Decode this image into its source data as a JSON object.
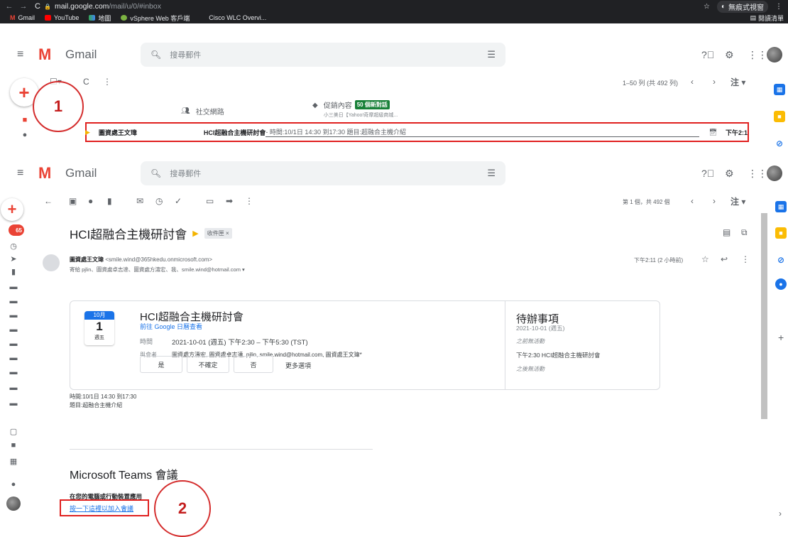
{
  "browser": {
    "url_host": "mail.google.com",
    "url_path": "/mail/u/0/#inbox",
    "incognito_label": "無痕式視窗",
    "bookmarks": [
      "Gmail",
      "YouTube",
      "地圖",
      "vSphere Web 客戶端",
      "Cisco WLC Overvi..."
    ],
    "reading_list": "閱讀清單"
  },
  "gmail": {
    "label": "Gmail",
    "search_placeholder": "搜尋郵件"
  },
  "inbox": {
    "pagination": "1–50 列 (共 492 列)",
    "lang": "注",
    "tabs": {
      "social": "社交網路",
      "promo": "促銷內容",
      "promo_badge": "50 個新對話",
      "promo_sub": "小三美日【Yahoo!奇摩超級商城..."
    },
    "row": {
      "sender": "圖資處王文瑋",
      "subject": "HCI超融合主機研討會",
      "snippet": " - 時間:10/1日 14:30 到17:30 題目:超融合主機介紹",
      "time": "下午2:1"
    },
    "marker": "1"
  },
  "message": {
    "pagination": "第 1 個，共 492 個",
    "lang": "注",
    "subject": "HCI超融合主機研討會",
    "label_chip": "收件匣 ×",
    "unread_badge": "65",
    "from_name": "圖資處王文瑋",
    "from_email": "<smile.wind@365hkedu.onmicrosoft.com>",
    "recipients": "寄給 pjlin、圖資處卓志達、圖資處方濤宏、我、smile.wind@hotmail.com ▾",
    "time": "下午2:11 (2 小時前)",
    "cal": {
      "month": "10月",
      "day": "1",
      "weekday": "週五",
      "title": "HCI超融合主機研討會",
      "gcal_link": "前往 Google 日曆查看",
      "time_label": "時間",
      "time_value": "2021-10-01 (週五) 下午2:30 – 下午5:30 (TST)",
      "guests_label": "與會者",
      "guests_value": "圖資處方濤宏, 圖資處卓志達, pjlin, smile.wind@hotmail.com, 圖資處王文瑋*",
      "rsvp_yes": "是",
      "rsvp_maybe": "不確定",
      "rsvp_no": "否",
      "rsvp_more": "更多選項",
      "agenda_title": "待辦事項",
      "agenda_date": "2021-10-01 (週五)",
      "agenda_before": "之前無活動",
      "agenda_event": "下午2:30  HCI超融合主機研討會",
      "agenda_after": "之後無活動"
    },
    "body_line1": "時間:10/1日 14:30 到17:30",
    "body_line2": "題目:超融合主機介紹",
    "teams_title": "Microsoft Teams 會議",
    "teams_sub": "在您的電腦或行動裝置應用",
    "join_link": "按一下這裡以加入會議",
    "marker": "2"
  }
}
